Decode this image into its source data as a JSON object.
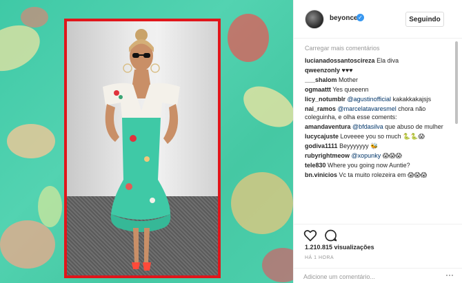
{
  "post": {
    "username": "beyonce",
    "follow_label": "Seguindo",
    "load_more": "Carregar mais comentários",
    "views": "1.210.815 visualizações",
    "time": "HÁ 1 HORA",
    "add_comment_placeholder": "Adicione um comentário...",
    "more_icon": "···"
  },
  "comments": [
    {
      "user": "lucianadossantoscireza",
      "text": "Ela diva",
      "mention": ""
    },
    {
      "user": "qweenzonly",
      "text": "♥♥♥",
      "mention": ""
    },
    {
      "user": "___shalom",
      "text": "Mother",
      "mention": ""
    },
    {
      "user": "ogmaattt",
      "text": "Yes queeenn",
      "mention": ""
    },
    {
      "user": "licy_notumblr",
      "mention": "@agustinofficial",
      "text": "kakakkakajsjs"
    },
    {
      "user": "nai_ramos",
      "mention": "@marcelatavaresmel",
      "text": "chora não coleguinha, e olha esse coments:"
    },
    {
      "user": "amandaventura",
      "mention": "@bfdasilva",
      "text": "que abuso de mulher"
    },
    {
      "user": "lucycajuste",
      "text": "Loveeee you so much 🐍🐍😱",
      "mention": ""
    },
    {
      "user": "godiva1111",
      "text": "Beyyyyyyy 🐝",
      "mention": ""
    },
    {
      "user": "rubyrightmeow",
      "mention": "@xopunky",
      "text": "😱😱😱"
    },
    {
      "user": "tele830",
      "text": "Where you going now Auntie?",
      "mention": ""
    },
    {
      "user": "bn.vinicios",
      "text": "Vc ta muito rolezeira em 😱😱😱",
      "mention": ""
    }
  ],
  "icons": {
    "verified": "verified-badge-icon",
    "like": "heart-icon",
    "comment": "comment-bubble-icon",
    "more": "more-options-icon"
  },
  "colors": {
    "frame": "#e0161b",
    "verified": "#3897f0",
    "mention": "#003569",
    "background_print": "#45c8a3"
  }
}
